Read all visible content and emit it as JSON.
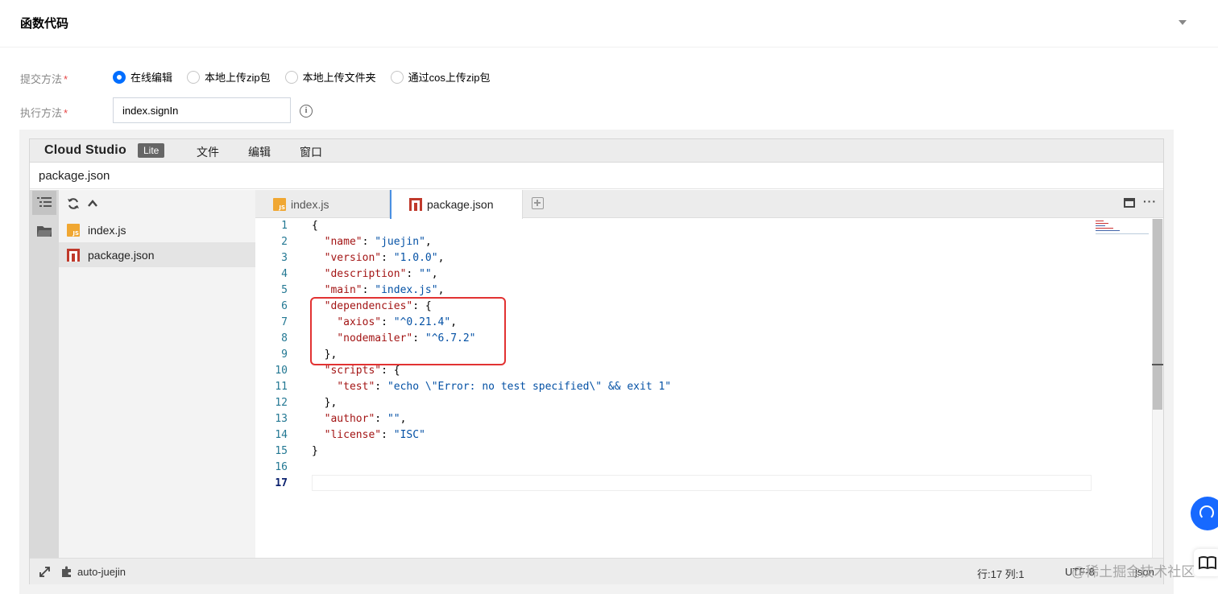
{
  "section": {
    "title": "函数代码"
  },
  "form": {
    "submit_label": "提交方法",
    "required_mark": "*",
    "submit_options": [
      {
        "label": "在线编辑",
        "checked": true
      },
      {
        "label": "本地上传zip包",
        "checked": false
      },
      {
        "label": "本地上传文件夹",
        "checked": false
      },
      {
        "label": "通过cos上传zip包",
        "checked": false
      }
    ],
    "handler_label": "执行方法",
    "handler_value": "index.signIn",
    "info_glyph": "i"
  },
  "ide": {
    "brand": "Cloud Studio",
    "brand_badge": "Lite",
    "menu": [
      "文件",
      "编辑",
      "窗口"
    ],
    "path": "package.json",
    "explorer_files": [
      {
        "name": "index.js",
        "icon": "js-file-icon",
        "selected": false
      },
      {
        "name": "package.json",
        "icon": "npm-file-icon",
        "selected": true
      }
    ],
    "tabs": [
      {
        "name": "index.js",
        "icon": "js-file-icon",
        "active": false
      },
      {
        "name": "package.json",
        "icon": "npm-file-icon",
        "active": true
      }
    ],
    "more_glyph": "···",
    "code_lines": [
      "{",
      "  \"name\": \"juejin\",",
      "  \"version\": \"1.0.0\",",
      "  \"description\": \"\",",
      "  \"main\": \"index.js\",",
      "  \"dependencies\": {",
      "    \"axios\": \"^0.21.4\",",
      "    \"nodemailer\": \"^6.7.2\"",
      "  },",
      "  \"scripts\": {",
      "    \"test\": \"echo \\\"Error: no test specified\\\" && exit 1\"",
      "  },",
      "  \"author\": \"\",",
      "  \"license\": \"ISC\"",
      "}",
      "",
      ""
    ],
    "current_line": 17,
    "highlight_lines": [
      6,
      9
    ],
    "highlight_color": "#e23232",
    "status": {
      "project": "auto-juejin",
      "cursor": "行:17 列:1",
      "encoding": "UTF-8",
      "language": "json"
    }
  },
  "watermark": "@稀土掘金技术社区",
  "colors": {
    "accent": "#006eff",
    "required": "#e54545",
    "json_key": "#a31515",
    "json_string": "#0451a5",
    "line_number": "#237893"
  }
}
